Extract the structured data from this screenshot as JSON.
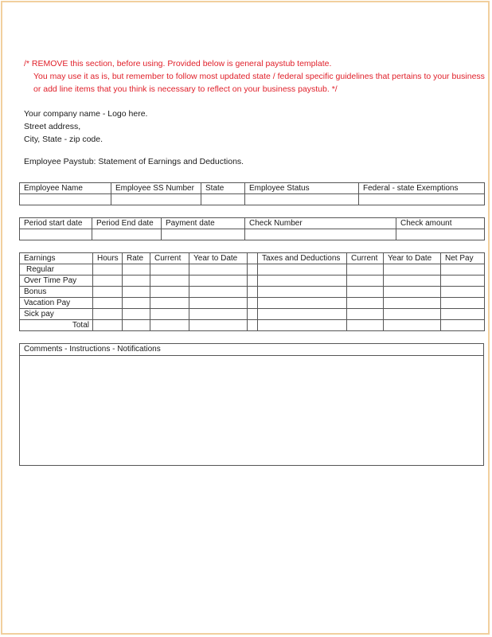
{
  "notice": {
    "line1": "/* REMOVE  this section,  before using.   Provided below is general  paystub template.",
    "line2": "You may use it as is, but remember to follow most updated state / federal specific guidelines that pertains to your business",
    "line3": "or add line items that you think is necessary to reflect on your business paystub. */",
    "color": "#e0202a"
  },
  "company": {
    "name": "Your company name - Logo here.",
    "street": "Street address,",
    "city": "City, State - zip code."
  },
  "title": "Employee Paystub:   Statement of Earnings and Deductions.",
  "employee_table": {
    "headers": [
      "Employee Name",
      "Employee SS Number",
      "State",
      "Employee Status",
      "Federal - state Exemptions"
    ],
    "values": [
      "",
      "",
      "",
      "",
      ""
    ]
  },
  "period_table": {
    "headers": [
      "Period start date",
      "Period End date",
      "Payment date",
      "Check Number",
      "Check amount"
    ],
    "values": [
      "",
      "",
      "",
      "",
      ""
    ]
  },
  "earnings_table": {
    "headers": [
      "Earnings",
      "Hours",
      "Rate",
      "Current",
      "Year to Date",
      "",
      "Taxes and Deductions",
      "Current",
      "Year to Date",
      "Net Pay"
    ],
    "rows": [
      {
        "label": "Regular"
      },
      {
        "label": "Over Time Pay"
      },
      {
        "label": "Bonus"
      },
      {
        "label": "Vacation Pay"
      },
      {
        "label": "Sick pay"
      },
      {
        "label": "Total"
      }
    ]
  },
  "comments": {
    "header": "Comments - Instructions - Notifications",
    "body": ""
  }
}
